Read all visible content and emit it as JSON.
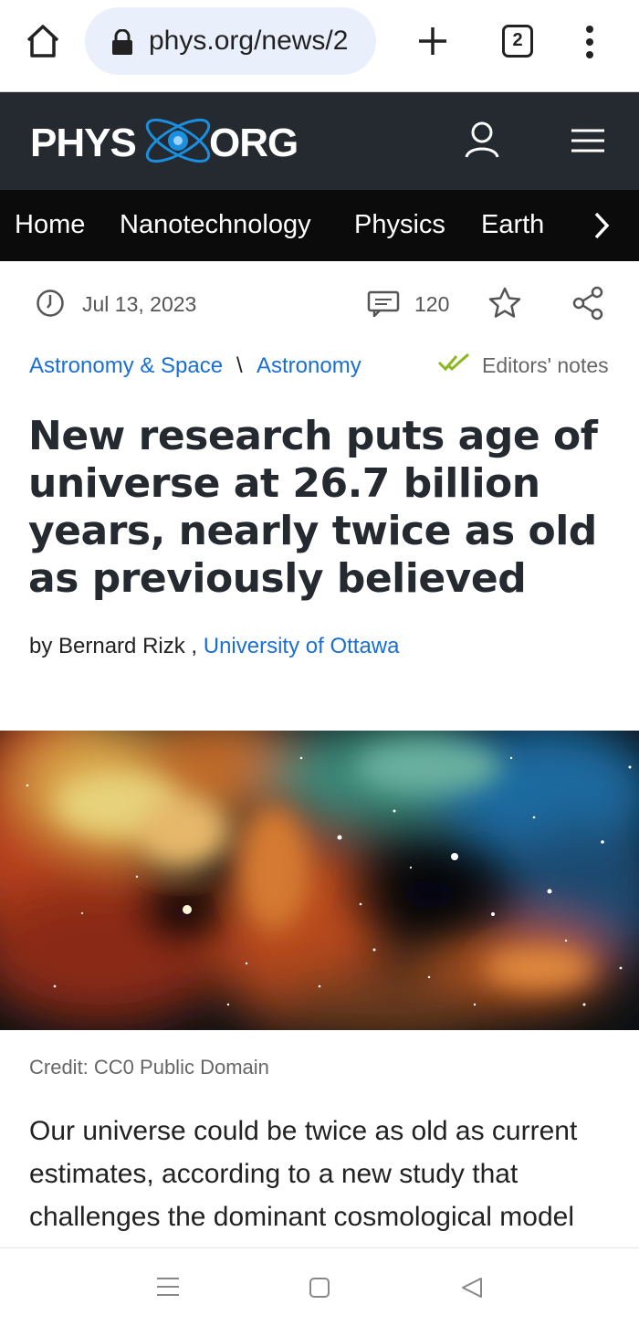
{
  "browser": {
    "url": "phys.org/news/2",
    "tab_count": "2",
    "icons": [
      "home-icon",
      "lock-icon",
      "plus-icon",
      "tabs-icon",
      "overflow-menu-icon"
    ]
  },
  "site": {
    "logo_left": "PHYS",
    "logo_right": "ORG",
    "colors": {
      "header_bg": "#252a30",
      "nav_bg": "#0b0b0b",
      "link": "#1a6fd6",
      "check": "#8bb71f"
    }
  },
  "nav": {
    "items": [
      "Home",
      "Nanotechnology",
      "Physics",
      "Earth"
    ]
  },
  "article": {
    "date": "Jul 13, 2023",
    "comment_count": "120",
    "category": "Astronomy & Space",
    "category_sep": "\\",
    "subcategory": "Astronomy",
    "editors_notes": "Editors' notes",
    "title": "New research puts age of universe at 26.7 billion years, nearly twice as old as previously believed",
    "byline_prefix": "by Bernard Rizk ,",
    "affiliation": "University of Ottawa",
    "image_credit": "Credit: CC0 Public Domain",
    "body": "Our universe could be twice as old as current estimates, according to a new study that challenges the dominant cosmological model"
  }
}
